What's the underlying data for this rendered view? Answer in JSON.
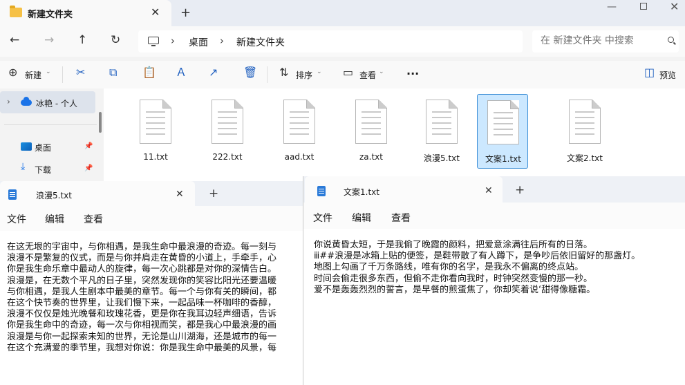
{
  "explorer": {
    "tab_title": "新建文件夹",
    "breadcrumb": [
      "桌面",
      "新建文件夹"
    ],
    "search_placeholder": "在 新建文件夹 中搜索",
    "toolbar": {
      "new_label": "新建",
      "sort_label": "排序",
      "view_label": "查看",
      "more_label": "···",
      "preview_label": "预览"
    },
    "nav": {
      "user_label": "冰艳 - 个人",
      "desktop_label": "桌面",
      "download_label": "下载"
    },
    "files": [
      {
        "name": "11.txt",
        "selected": false
      },
      {
        "name": "222.txt",
        "selected": false
      },
      {
        "name": "aad.txt",
        "selected": false
      },
      {
        "name": "za.txt",
        "selected": false
      },
      {
        "name": "浪漫5.txt",
        "selected": false
      },
      {
        "name": "文案1.txt",
        "selected": true
      },
      {
        "name": "文案2.txt",
        "selected": false
      }
    ]
  },
  "notepad_left": {
    "tab_title": "浪漫5.txt",
    "menu": [
      "文件",
      "编辑",
      "查看"
    ],
    "lines": [
      "在这无垠的宇宙中，与你相遇，是我生命中最浪漫的奇迹。每一刻与",
      "浪漫不是繁复的仪式，而是与你并肩走在黄昏的小道上，手牵手，心",
      "你是我生命乐章中最动人的旋律，每一次心跳都是对你的深情告白。",
      "浪漫是，在无数个平凡的日子里，突然发现你的笑容比阳光还要温暖",
      "与你相遇，是我人生剧本中最美的章节。每一个与你有关的瞬间，都",
      "在这个快节奏的世界里，让我们慢下来，一起品味一杯咖啡的香醇，",
      "浪漫不仅仅是烛光晚餐和玫瑰花香，更是你在我耳边轻声细语，告诉",
      "你是我生命中的奇迹，每一次与你相视而笑，都是我心中最浪漫的画",
      "浪漫是与你一起探索未知的世界，无论是山川湖海，还是城市的每一",
      "在这个充满爱的季节里，我想对你说：你是我生命中最美的风景，每"
    ]
  },
  "notepad_right": {
    "tab_title": "文案1.txt",
    "menu": [
      "文件",
      "编辑",
      "查看"
    ],
    "lines": [
      "你说黄昏太短，于是我偷了晚霞的颜料，把爱意涂满往后所有的日落。",
      "ⅲ##浪漫是冰箱上贴的便签，是鞋带散了有人蹲下，是争吵后依旧留好的那盏灯。",
      "地图上勾画了千万条路线，唯有你的名字，是我永不偏离的终点站。",
      "时间会偷走很多东西，但偷不走你看向我时，时钟突然变慢的那一秒。",
      "爱不是轰轰烈烈的誓言，是早餐的煎蛋焦了，你却笑着说‘甜得像糖霜。"
    ]
  }
}
